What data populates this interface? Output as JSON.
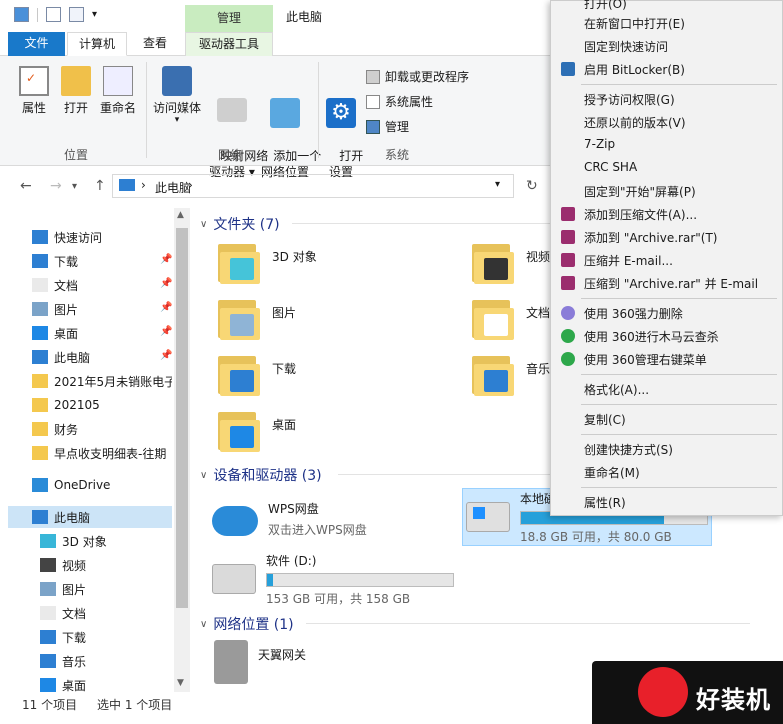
{
  "titlebar": {
    "context_tab_header": "管理",
    "window_title": "此电脑"
  },
  "ribbon_tabs": [
    "文件",
    "计算机",
    "查看",
    "驱动器工具"
  ],
  "ribbon": {
    "location": {
      "label": "位置",
      "buttons": [
        "属性",
        "打开",
        "重命名"
      ]
    },
    "network": {
      "label": "网络",
      "buttons": [
        "访问媒体",
        "映射网络\n驱动器 ▾",
        "添加一个\n网络位置"
      ]
    },
    "system": {
      "label": "系统",
      "open_settings": "打开\n设置",
      "small": [
        "卸载或更改程序",
        "系统属性",
        "管理"
      ]
    }
  },
  "address": {
    "path": "此电脑"
  },
  "nav": [
    {
      "label": "快速访问",
      "icon": "star-icon",
      "pin": false
    },
    {
      "label": "下载",
      "icon": "download-icon",
      "pin": true
    },
    {
      "label": "文档",
      "icon": "document-icon",
      "pin": true
    },
    {
      "label": "图片",
      "icon": "picture-icon",
      "pin": true
    },
    {
      "label": "桌面",
      "icon": "desktop-icon",
      "pin": true
    },
    {
      "label": "此电脑",
      "icon": "computer-icon",
      "pin": true
    },
    {
      "label": "2021年5月未销账电子",
      "icon": "folder-icon",
      "pin": false
    },
    {
      "label": "202105",
      "icon": "folder-icon",
      "pin": false
    },
    {
      "label": "财务",
      "icon": "folder-icon",
      "pin": false
    },
    {
      "label": "早点收支明细表-往期",
      "icon": "folder-icon",
      "pin": false
    },
    {
      "label": "OneDrive",
      "icon": "cloud-icon",
      "pin": false
    },
    {
      "label": "此电脑",
      "icon": "computer-icon",
      "pin": false
    },
    {
      "label": "3D 对象",
      "icon": "cube-icon",
      "pin": false
    },
    {
      "label": "视频",
      "icon": "video-icon",
      "pin": false
    },
    {
      "label": "图片",
      "icon": "picture-icon",
      "pin": false
    },
    {
      "label": "文档",
      "icon": "document-icon",
      "pin": false
    },
    {
      "label": "下载",
      "icon": "download-icon",
      "pin": false
    },
    {
      "label": "音乐",
      "icon": "music-icon",
      "pin": false
    },
    {
      "label": "桌面",
      "icon": "desktop-icon",
      "pin": false
    }
  ],
  "sections": {
    "folders": "文件夹 (7)",
    "drives": "设备和驱动器 (3)",
    "network": "网络位置 (1)"
  },
  "folders": [
    "3D 对象",
    "视频",
    "图片",
    "文档",
    "下载",
    "音乐",
    "桌面"
  ],
  "drives": {
    "wps": {
      "name": "WPS网盘",
      "sub": "双击进入WPS网盘"
    },
    "c": {
      "name": "本地磁",
      "free": "18.8 GB 可用，共 80.0 GB",
      "used_fraction": 0.77
    },
    "d": {
      "name": "软件 (D:)",
      "free": "153 GB 可用，共 158 GB",
      "used_fraction": 0.03
    }
  },
  "network_location": "天翼网关",
  "context_menu": [
    "打开(O)",
    "在新窗口中打开(E)",
    "固定到快速访问",
    "启用 BitLocker(B)",
    "授予访问权限(G)",
    "还原以前的版本(V)",
    "7-Zip",
    "CRC SHA",
    "固定到\"开始\"屏幕(P)",
    "添加到压缩文件(A)...",
    "添加到 \"Archive.rar\"(T)",
    "压缩并 E-mail...",
    "压缩到 \"Archive.rar\" 并 E-mail",
    "使用 360强力删除",
    "使用 360进行木马云查杀",
    "使用 360管理右键菜单",
    "格式化(A)...",
    "复制(C)",
    "创建快捷方式(S)",
    "重命名(M)",
    "属性(R)"
  ],
  "status": {
    "count": "11 个项目",
    "selected": "选中 1 个项目"
  },
  "watermark": "好装机",
  "colors": {
    "accent": "#1979ca",
    "selection": "#cce4f7",
    "section_header": "#1e3287"
  }
}
